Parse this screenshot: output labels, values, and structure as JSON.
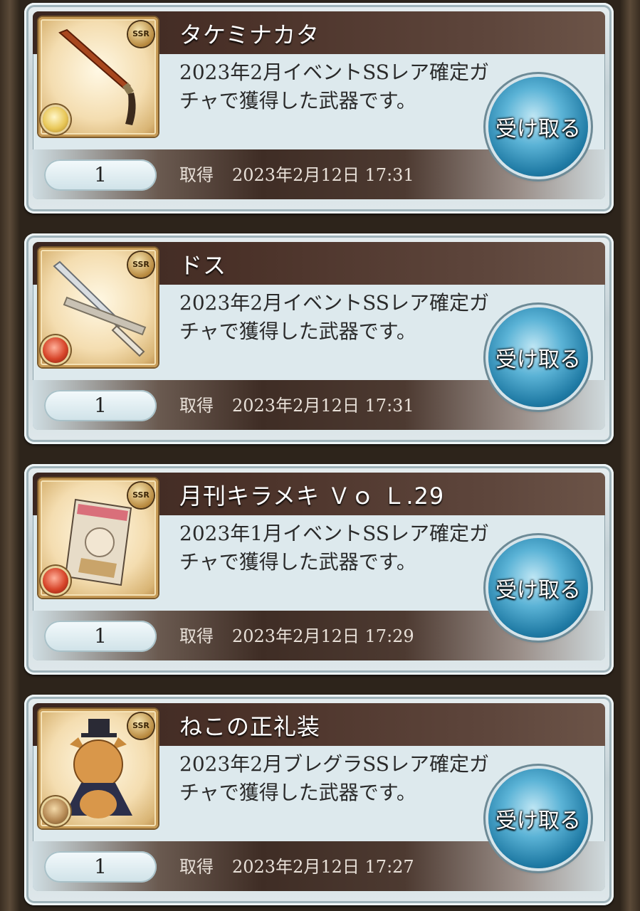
{
  "items": [
    {
      "name": "タケミナカタ",
      "description": "2023年2月イベントSSレア確定ガチャで獲得した武器です。",
      "count": "1",
      "obtained_label": "取得",
      "obtained_date": "2023年2月12日",
      "obtained_time": "17:31",
      "rarity": "SSR",
      "element": "light-element-icon",
      "receive_label": "受け取る"
    },
    {
      "name": "ドス",
      "description": "2023年2月イベントSSレア確定ガチャで獲得した武器です。",
      "count": "1",
      "obtained_label": "取得",
      "obtained_date": "2023年2月12日",
      "obtained_time": "17:31",
      "rarity": "SSR",
      "element": "fire-element-icon",
      "receive_label": "受け取る"
    },
    {
      "name": "月刊キラメキ Ｖｏ Ｌ.29",
      "description": "2023年1月イベントSSレア確定ガチャで獲得した武器です。",
      "count": "1",
      "obtained_label": "取得",
      "obtained_date": "2023年2月12日",
      "obtained_time": "17:29",
      "rarity": "SSR",
      "element": "fire-element-icon",
      "receive_label": "受け取る"
    },
    {
      "name": "ねこの正礼装",
      "description": "2023年2月ブレグラSSレア確定ガチャで獲得した武器です。",
      "count": "1",
      "obtained_label": "取得",
      "obtained_date": "2023年2月12日",
      "obtained_time": "17:27",
      "rarity": "SSR",
      "element": "earth-element-icon",
      "receive_label": "受け取る"
    }
  ]
}
